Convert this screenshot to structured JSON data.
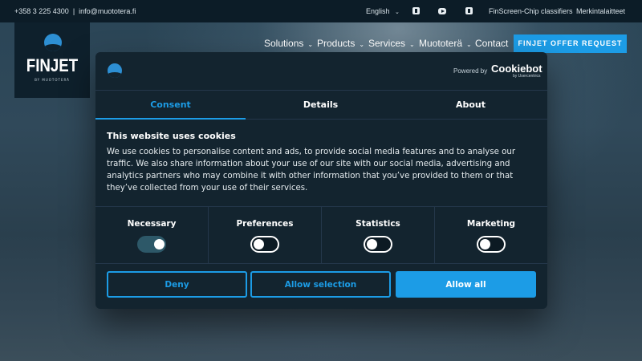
{
  "topbar": {
    "phone": "+358 3 225 4300",
    "separator": "|",
    "email": "info@muototera.fi",
    "language": "English",
    "social_icons": [
      "linkedin-icon",
      "youtube-icon",
      "twitter-icon"
    ],
    "links": [
      "FinScreen-Chip classifiers",
      "Merkintalaitteet"
    ]
  },
  "logo": {
    "wordmark": "FINJET",
    "subline": "BY MUOTOTERÄ"
  },
  "nav": {
    "items": [
      {
        "label": "Solutions",
        "has_dropdown": true
      },
      {
        "label": "Products",
        "has_dropdown": true
      },
      {
        "label": "Services",
        "has_dropdown": true
      },
      {
        "label": "Muototerä",
        "has_dropdown": true
      },
      {
        "label": "Contact",
        "has_dropdown": false
      }
    ],
    "cta": "FINJET OFFER REQUEST"
  },
  "cookie_dialog": {
    "powered_by": "Powered by",
    "brand": "Cookiebot",
    "brand_sub": "by Usercentrics",
    "tabs": [
      {
        "label": "Consent",
        "active": true
      },
      {
        "label": "Details",
        "active": false
      },
      {
        "label": "About",
        "active": false
      }
    ],
    "heading": "This website uses cookies",
    "body": "We use cookies to personalise content and ads, to provide social media features and to analyse our traffic. We also share information about your use of our site with our social media, advertising and analytics partners who may combine it with other information that you’ve provided to them or that they’ve collected from your use of their services.",
    "categories": [
      {
        "label": "Necessary",
        "enabled": true
      },
      {
        "label": "Preferences",
        "enabled": false
      },
      {
        "label": "Statistics",
        "enabled": false
      },
      {
        "label": "Marketing",
        "enabled": false
      }
    ],
    "buttons": {
      "deny": "Deny",
      "allow_selection": "Allow selection",
      "allow_all": "Allow all"
    }
  },
  "colors": {
    "accent": "#1c9ce6",
    "topbar_bg": "#0c1c27",
    "dialog_bg": "#13242f"
  }
}
